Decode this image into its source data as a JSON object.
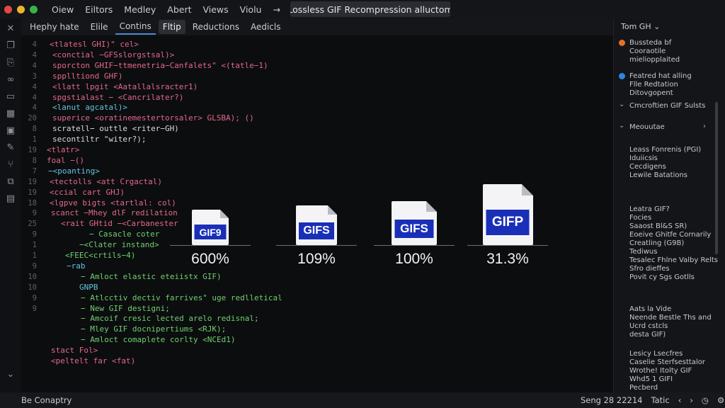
{
  "colors": {
    "close": "#e5483f",
    "minimize": "#e8b530",
    "maximize": "#37b44a",
    "accent": "#4a8ad9",
    "gif_label": "#1a2fb8"
  },
  "menu": [
    "Oiew",
    "Eiltors",
    "Medley",
    "Abert",
    "Views",
    "Violu",
    "→"
  ],
  "window_title": "Lossless GIF Recompression alluctom",
  "tabs": [
    "Hephy hate",
    "Elile",
    "Contins",
    "Fltip",
    "Reductions",
    "Aedicls"
  ],
  "activity_icons": [
    "close-icon",
    "files-icon",
    "copy-icon",
    "link-icon",
    "book-icon",
    "grid-icon",
    "image-icon",
    "edit-icon",
    "git-icon",
    "puzzle-icon",
    "package-icon",
    "chevron-down-icon"
  ],
  "code": {
    "line_numbers": [
      "4",
      "4",
      "4",
      "3",
      "4",
      "4",
      "4",
      "20",
      "8",
      "1",
      "19",
      "8",
      "7",
      "19",
      "19",
      "18",
      "9",
      "25",
      "9",
      "1",
      "1",
      "9",
      "10",
      "10",
      "9",
      "9"
    ],
    "lines": [
      {
        "text": "<tlatesl GHI)\" cel>",
        "color": "pink",
        "indent": 40
      },
      {
        "text": "<conctial −GFSslorgstsal)>",
        "color": "pink",
        "indent": 44
      },
      {
        "text": "sporcton GHIF−ttmenetria−Canfalets\" <(tatle−1)",
        "color": "pink",
        "indent": 44
      },
      {
        "text": "spplltiond GHF)",
        "color": "pink",
        "indent": 44
      },
      {
        "text": "<llatt lpgit <Aatallalsracter1)",
        "color": "pink",
        "indent": 44
      },
      {
        "text": "spgstialast − <Cancrilater?)",
        "color": "pink",
        "indent": 44
      },
      {
        "text": "<lanut agcatal)>",
        "color": "cyan",
        "indent": 44
      },
      {
        "text": "superice <oratinemestertorsaler> GLSBA); ()",
        "color": "pink",
        "indent": 44
      },
      {
        "text": "scratell− outtle <riter−GH)",
        "color": "white",
        "indent": 44
      },
      {
        "text": "secontiltr \"witer?);",
        "color": "white",
        "indent": 44
      },
      {
        "text": "<tlatr>",
        "color": "pink",
        "indent": 36
      },
      {
        "text": "foal −()",
        "color": "pink",
        "indent": 36
      },
      {
        "text": "−<poanting>",
        "color": "cyan",
        "indent": 38
      },
      {
        "text": "<tectolls <att Crgactal)",
        "color": "pink",
        "indent": 40
      },
      {
        "text": "<ccial cart GHJ)",
        "color": "pink",
        "indent": 40
      },
      {
        "text": "<lgpve bigts <tartlal: col)",
        "color": "pink",
        "indent": 40
      },
      {
        "text": "scanct −Mhey dlF redilation",
        "color": "pink",
        "indent": 42
      },
      {
        "text": "<rait GHtid −<Carbanester",
        "color": "pink",
        "indent": 56
      },
      {
        "text": "− Casacle coter",
        "color": "green",
        "indent": 96
      },
      {
        "text": "−<Clater instand>",
        "color": "green",
        "indent": 82
      },
      {
        "text": "<FEEC<crtils−4)",
        "color": "green",
        "indent": 62
      },
      {
        "text": "−rab",
        "color": "cyan",
        "indent": 64
      },
      {
        "text": "− Amloct elastic eteiistx GIF)",
        "color": "green",
        "indent": 84
      },
      {
        "text": "GNPB",
        "color": "cyan",
        "indent": 82
      },
      {
        "text": "− Atlcctiv dectiv farrives\" uge redlletical",
        "color": "green",
        "indent": 84
      },
      {
        "text": "− New GIF destigni;",
        "color": "green",
        "indent": 84
      },
      {
        "text": "− Amcoif cresic lected arelo redisnal;",
        "color": "green",
        "indent": 84
      },
      {
        "text": "− Mley GIF docnipertiums <RJK);",
        "color": "green",
        "indent": 84
      },
      {
        "text": "− Amloct comaplete corlty <NCEd1)",
        "color": "green",
        "indent": 84
      },
      {
        "text": "stact Fol>",
        "color": "pink",
        "indent": 42
      },
      {
        "text": "<peltelt far <fat)",
        "color": "pink",
        "indent": 42
      }
    ]
  },
  "gif_files": [
    {
      "label": "GIF9",
      "percent": "600%",
      "level": 0
    },
    {
      "label": "GIFS",
      "percent": "109%",
      "level": 1
    },
    {
      "label": "GIFS",
      "percent": "100%",
      "level": 2
    },
    {
      "label": "GIFP",
      "percent": "31.3%",
      "level": 3
    }
  ],
  "right_panel": {
    "header": "Tom GH ⌄",
    "items": [
      {
        "lines": [
          "Bussteda bf",
          "Cooraotile",
          "mieliopplaited"
        ],
        "marker": "dot",
        "marker_color": "#e2722a"
      },
      {
        "lines": [
          "Featred hat alling",
          "Flle Redtation",
          "Ditovgopent"
        ],
        "marker": "dot",
        "marker_color": "#2f86e0"
      },
      {
        "lines": [
          "Cmcroftien GIF Sulsts"
        ],
        "marker": "chevron"
      },
      {
        "lines": [
          "Meouutae"
        ],
        "marker": "chevron",
        "trail": "›"
      },
      {
        "lines": [
          "Leass Fonrenis (PGI)",
          "Iduiicsis",
          "Cecdigens",
          "Lewile Batations"
        ],
        "marker": "none"
      },
      {
        "lines": [
          "Leatra GIF?",
          "Focies",
          "Saaost Bl&S SR)",
          "Eoeive Ghitfe Cornarily",
          "Creatling (G9B)",
          "Tediwus",
          "Tesalec Fhlne Valby Relts",
          "Sfro dieffes",
          "Povit cy Sgs Gotlls"
        ],
        "marker": "none"
      },
      {
        "lines": [
          "Aats la Vide",
          "Neende Bestle Ths and",
          "Ucrd cstcls",
          "desta GIF)"
        ],
        "marker": "none"
      },
      {
        "lines": [
          "Lesicy Lsecfres",
          "Caselie Sterfsesttalor",
          "Wrothe! Itolty GIF",
          "Whd5 1 GIFI",
          "Pecberd"
        ],
        "marker": "none"
      }
    ]
  },
  "status": {
    "left": "Be Conaptry",
    "right": "Seng 28 22214",
    "lang": "Tatic",
    "icons": [
      "chevron-left-icon",
      "chevron-right-icon",
      "clock-icon",
      "settings-icon"
    ]
  }
}
